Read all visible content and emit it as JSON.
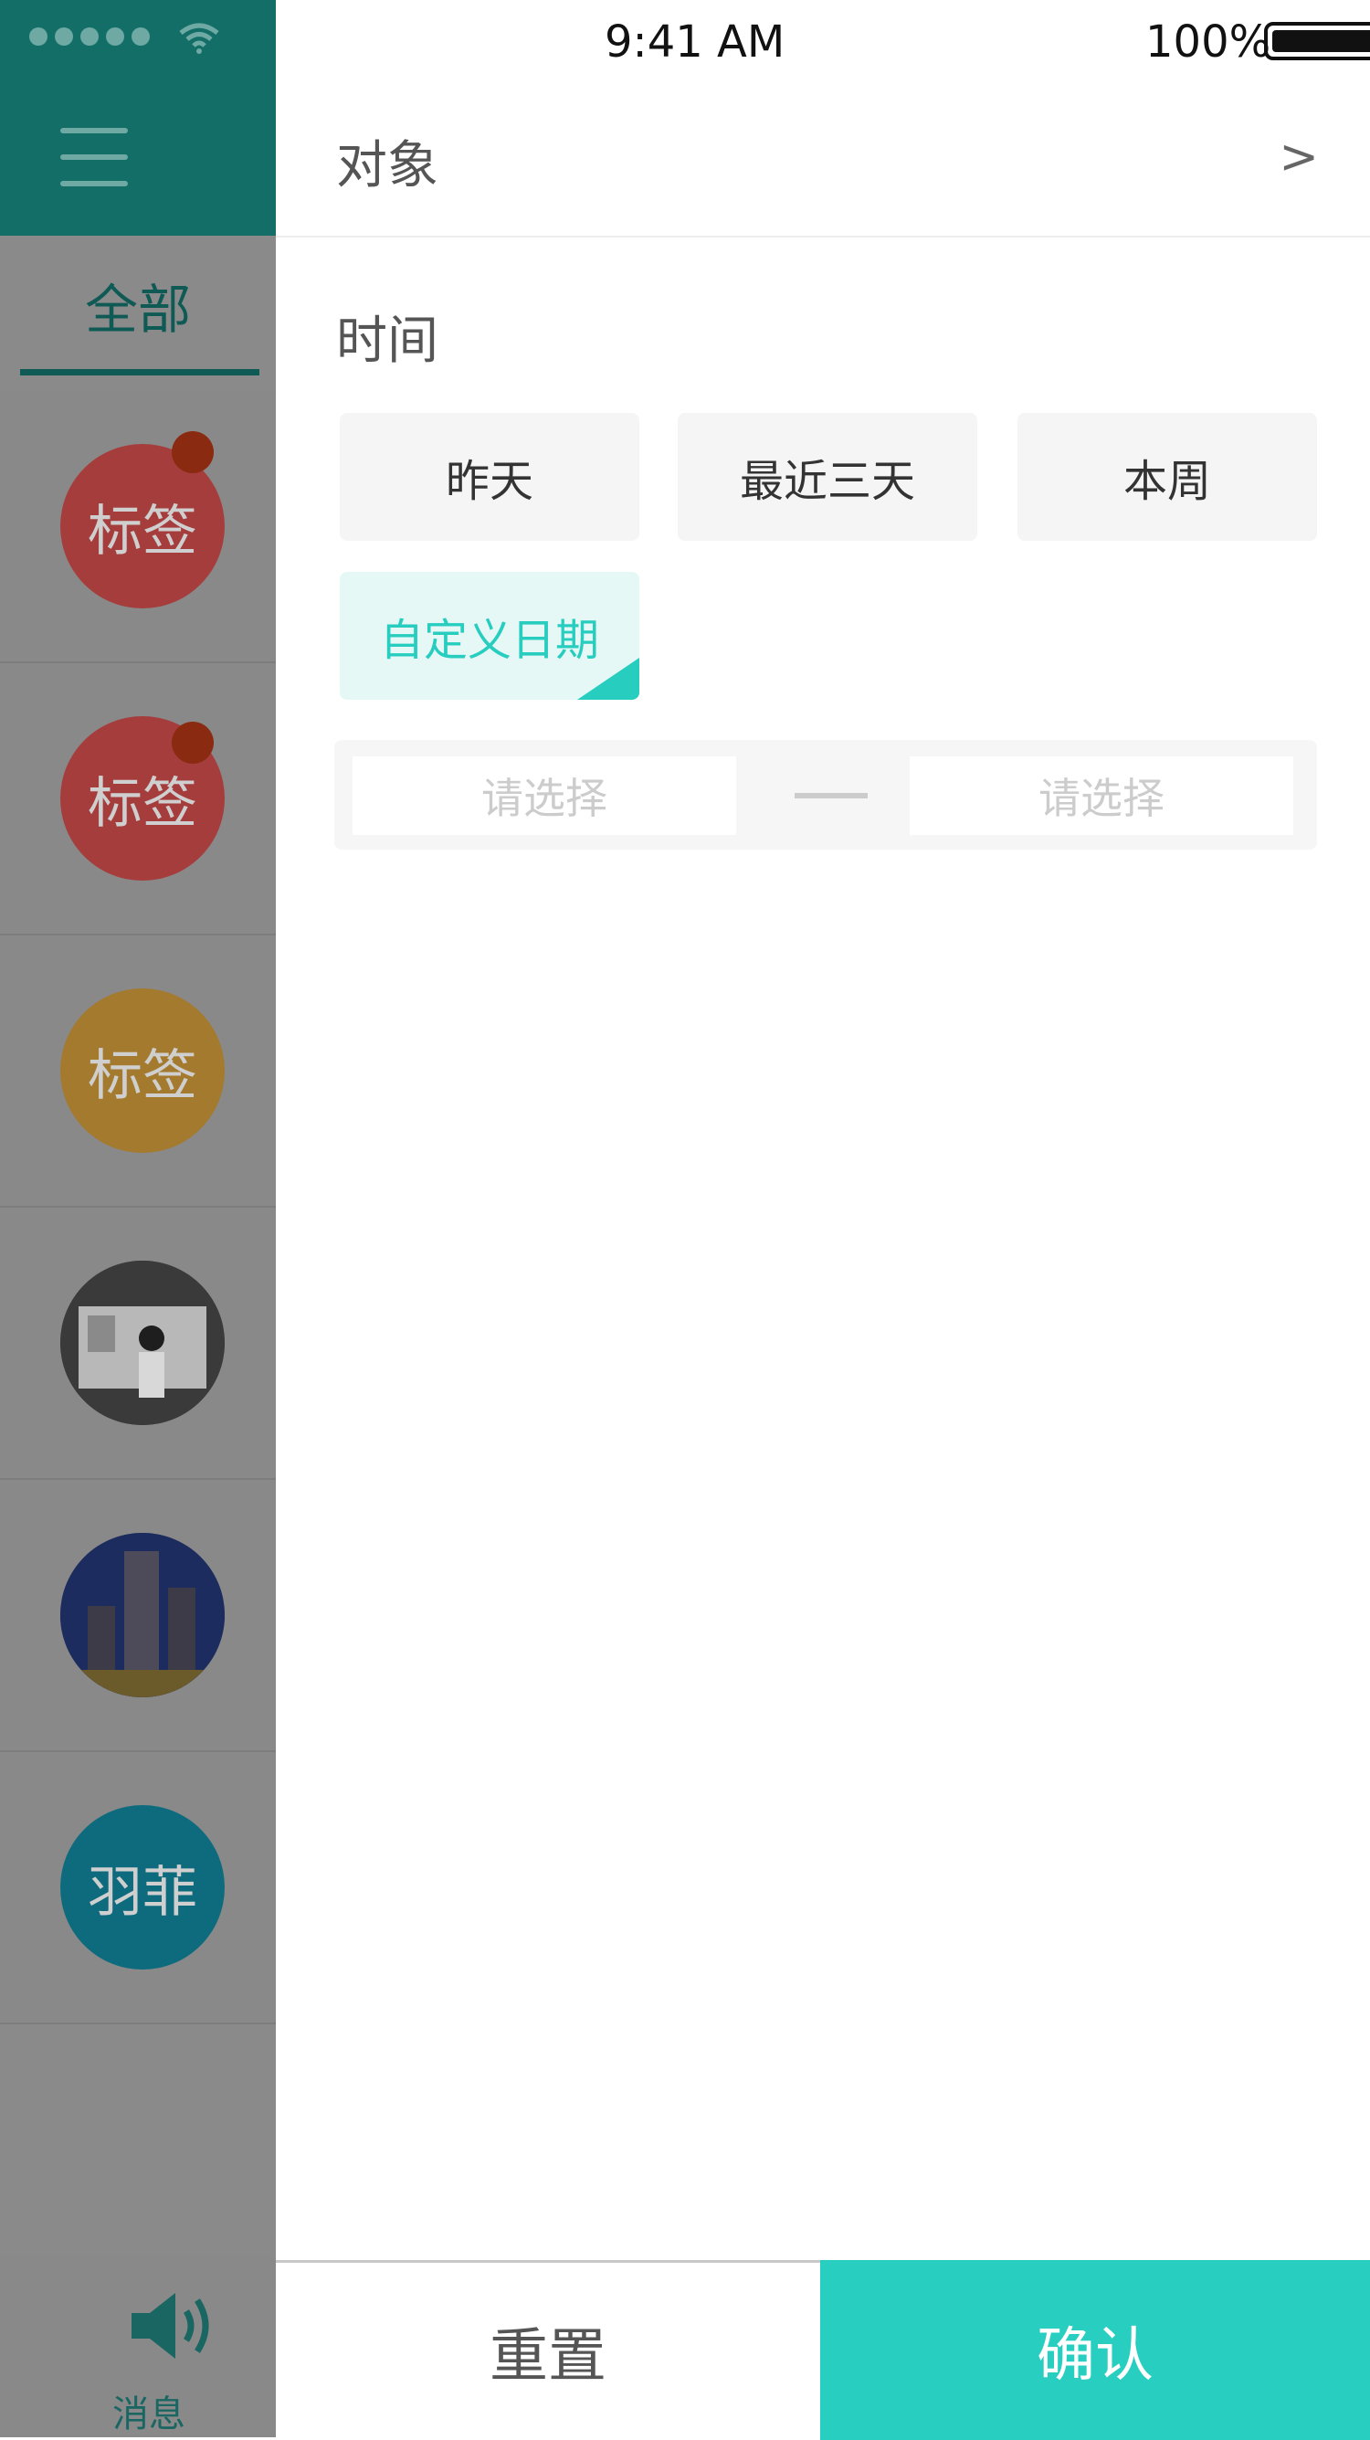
{
  "status_bar": {
    "time": "9:41 AM",
    "battery": "100%"
  },
  "sidebar": {
    "tab_label": "全部",
    "items": [
      {
        "label": "标签",
        "color": "#a63d3d",
        "badge": true
      },
      {
        "label": "标签",
        "color": "#a63d3d",
        "badge": true
      },
      {
        "label": "标签",
        "color": "#a47a2e",
        "badge": false
      },
      {
        "label": "",
        "type": "photo-person"
      },
      {
        "label": "",
        "type": "photo-city"
      },
      {
        "label": "羽菲",
        "color": "#0e6b7e",
        "badge": false
      }
    ],
    "footer_label": "消息"
  },
  "filter": {
    "object_label": "对象",
    "time_label": "时间",
    "options": [
      {
        "label": "昨天",
        "active": false
      },
      {
        "label": "最近三天",
        "active": false
      },
      {
        "label": "本周",
        "active": false
      },
      {
        "label": "自定义日期",
        "active": true
      }
    ],
    "start_placeholder": "请选择",
    "end_placeholder": "请选择"
  },
  "actions": {
    "reset_label": "重置",
    "confirm_label": "确认"
  },
  "colors": {
    "accent": "#28cfc0",
    "sidebar_header": "#136e68"
  }
}
